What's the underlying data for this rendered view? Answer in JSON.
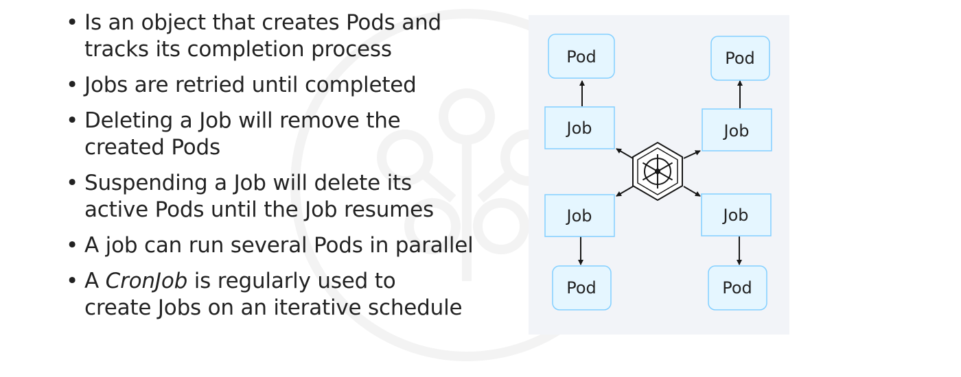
{
  "bullets": [
    {
      "line1": "Is an object that creates Pods and",
      "line2": "tracks its completion process"
    },
    {
      "line1": "Jobs are retried until completed"
    },
    {
      "line1": "Deleting a Job will remove the",
      "line2": "created Pods"
    },
    {
      "line1": "Suspending a Job will delete its",
      "line2": "active Pods until the Job resumes"
    },
    {
      "line1": "A job can run several Pods in parallel"
    },
    {
      "line1_prefix": "A ",
      "line1_em": "CronJob",
      "line1_suffix": " is regularly used to",
      "line2": "create Jobs on an iterative schedule"
    }
  ],
  "diagram": {
    "pod_label": "Pod",
    "job_label": "Job",
    "center_icon": "kubernetes-helm-icon",
    "colors": {
      "pod_fill": "#e5f6ff",
      "pod_stroke": "#82cfff",
      "job_fill": "#e5f6ff",
      "job_stroke": "#82cfff",
      "panel_bg": "#f2f4f8",
      "arrow": "#161616"
    }
  }
}
